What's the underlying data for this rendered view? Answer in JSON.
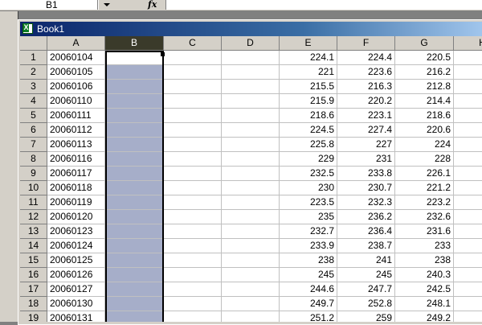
{
  "formula_bar": {
    "name_box": "B1",
    "fx_label": "fx",
    "formula": ""
  },
  "window": {
    "title": "Book1"
  },
  "columns": [
    "A",
    "B",
    "C",
    "D",
    "E",
    "F",
    "G",
    "H"
  ],
  "selected_column": "B",
  "rows": [
    {
      "num": "1",
      "a": "20060104",
      "e": "224.1",
      "f": "224.4",
      "g": "220.5"
    },
    {
      "num": "2",
      "a": "20060105",
      "e": "221",
      "f": "223.6",
      "g": "216.2"
    },
    {
      "num": "3",
      "a": "20060106",
      "e": "215.5",
      "f": "216.3",
      "g": "212.8"
    },
    {
      "num": "4",
      "a": "20060110",
      "e": "215.9",
      "f": "220.2",
      "g": "214.4"
    },
    {
      "num": "5",
      "a": "20060111",
      "e": "218.6",
      "f": "223.1",
      "g": "218.6"
    },
    {
      "num": "6",
      "a": "20060112",
      "e": "224.5",
      "f": "227.4",
      "g": "220.6"
    },
    {
      "num": "7",
      "a": "20060113",
      "e": "225.8",
      "f": "227",
      "g": "224"
    },
    {
      "num": "8",
      "a": "20060116",
      "e": "229",
      "f": "231",
      "g": "228"
    },
    {
      "num": "9",
      "a": "20060117",
      "e": "232.5",
      "f": "233.8",
      "g": "226.1"
    },
    {
      "num": "10",
      "a": "20060118",
      "e": "230",
      "f": "230.7",
      "g": "221.2"
    },
    {
      "num": "11",
      "a": "20060119",
      "e": "223.5",
      "f": "232.3",
      "g": "223.2"
    },
    {
      "num": "12",
      "a": "20060120",
      "e": "235",
      "f": "236.2",
      "g": "232.6"
    },
    {
      "num": "13",
      "a": "20060123",
      "e": "232.7",
      "f": "236.4",
      "g": "231.6"
    },
    {
      "num": "14",
      "a": "20060124",
      "e": "233.9",
      "f": "238.7",
      "g": "233"
    },
    {
      "num": "15",
      "a": "20060125",
      "e": "238",
      "f": "241",
      "g": "238"
    },
    {
      "num": "16",
      "a": "20060126",
      "e": "245",
      "f": "245",
      "g": "240.3"
    },
    {
      "num": "17",
      "a": "20060127",
      "e": "244.6",
      "f": "247.7",
      "g": "242.5"
    },
    {
      "num": "18",
      "a": "20060130",
      "e": "249.7",
      "f": "252.8",
      "g": "248.1"
    },
    {
      "num": "19",
      "a": "20060131",
      "e": "251.2",
      "f": "259",
      "g": "249.2"
    }
  ],
  "colors": {
    "selection_fill": "#a6aec9",
    "title_bar": "#0a246a"
  }
}
